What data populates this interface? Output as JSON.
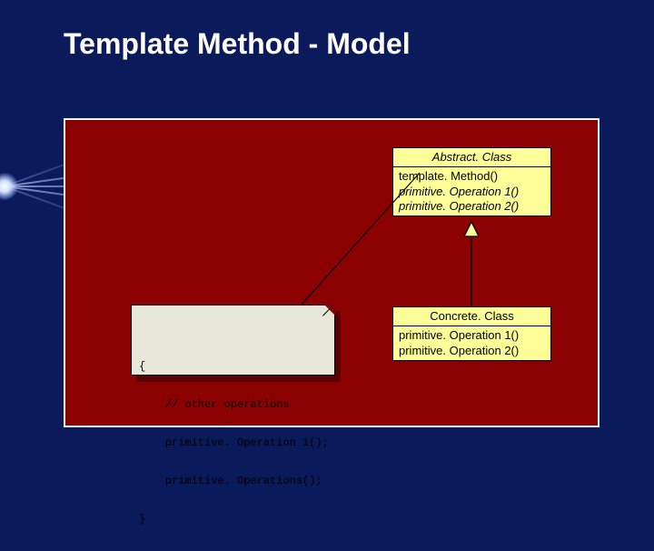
{
  "title": "Template Method - Model",
  "abstractClass": {
    "name": "Abstract. Class",
    "methods": {
      "templateMethod": "template. Method()",
      "primitiveOp1": "primitive. Operation 1()",
      "primitiveOp2": "primitive. Operation 2()"
    }
  },
  "concreteClass": {
    "name": "Concrete. Class",
    "methods": {
      "primitiveOp1": "primitive. Operation 1()",
      "primitiveOp2": "primitive. Operation 2()"
    }
  },
  "note": {
    "line1": "{",
    "line2": "    // other operations",
    "line3": "    primitive. Operation 1();",
    "line4": "    primitive. Operations();",
    "line5": "}"
  }
}
